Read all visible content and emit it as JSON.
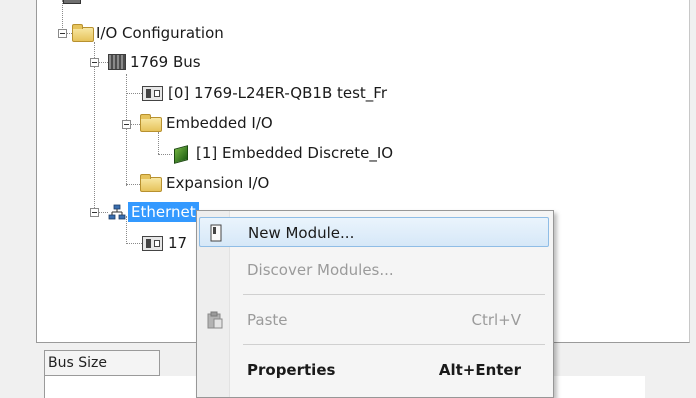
{
  "tree": {
    "io_configuration": "I/O Configuration",
    "bus": "1769 Bus",
    "controller": "[0] 1769-L24ER-QB1B test_Fr",
    "embedded_io": "Embedded I/O",
    "embedded_discrete": "[1] Embedded Discrete_IO",
    "expansion_io": "Expansion I/O",
    "ethernet": "Ethernet",
    "ethernet_child_partial": "17"
  },
  "grid": {
    "header_bus_size": "Bus Size"
  },
  "context_menu": {
    "items": [
      {
        "label": "New Module...",
        "shortcut": "",
        "state": "highlighted"
      },
      {
        "label": "Discover Modules...",
        "shortcut": "",
        "state": "disabled"
      },
      {
        "label": "Paste",
        "shortcut": "Ctrl+V",
        "state": "disabled"
      },
      {
        "label": "Properties",
        "shortcut": "Alt+Enter",
        "state": "bold"
      }
    ]
  },
  "colors": {
    "selection": "#3399ff",
    "menu_highlight": "#d6e8f8",
    "disabled_text": "#9b9b9b"
  }
}
